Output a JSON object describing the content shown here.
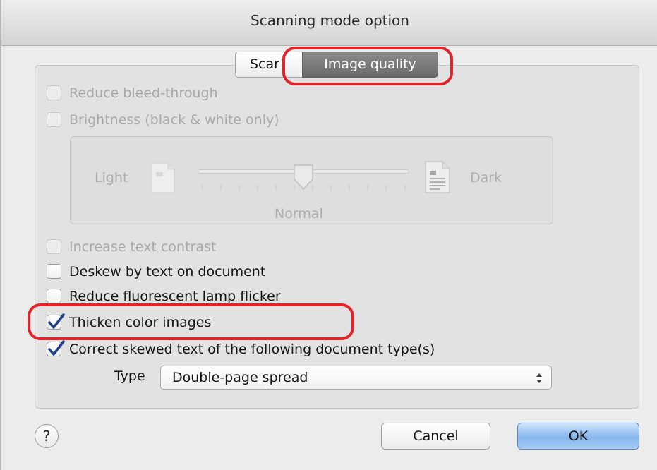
{
  "window": {
    "title": "Scanning mode option"
  },
  "tabs": [
    {
      "label": "Scan",
      "visible_label": "Scar",
      "selected": false
    },
    {
      "label": "Image quality",
      "selected": true
    }
  ],
  "options": {
    "reduce_bleed_through": {
      "label": "Reduce bleed-through",
      "checked": false,
      "enabled": false
    },
    "brightness": {
      "label": "Brightness (black & white only)",
      "checked": false,
      "enabled": false
    },
    "increase_text_contrast": {
      "label": "Increase text contrast",
      "checked": false,
      "enabled": false
    },
    "deskew_by_text": {
      "label": "Deskew by text on document",
      "checked": false,
      "enabled": true
    },
    "reduce_lamp_flicker": {
      "label": "Reduce fluorescent lamp flicker",
      "checked": false,
      "enabled": true
    },
    "thicken_color_images": {
      "label": "Thicken color images",
      "checked": true,
      "enabled": true
    },
    "correct_skewed_text": {
      "label": "Correct skewed text of the following document type(s)",
      "checked": true,
      "enabled": true
    }
  },
  "brightness_slider": {
    "min_label": "Light",
    "max_label": "Dark",
    "value_label": "Normal",
    "value_fraction": 0.5,
    "enabled": false
  },
  "type_select": {
    "label": "Type",
    "value": "Double-page spread"
  },
  "buttons": {
    "help": "?",
    "cancel": "Cancel",
    "ok": "OK"
  },
  "colors": {
    "highlight": "#e0242c",
    "selected_tab": "#7a7a7a",
    "checkmark": "#1f3f86",
    "ok_button": "#86b6ee"
  },
  "icons": {
    "light_doc": "page-light-icon",
    "dark_doc": "page-dark-icon",
    "select_arrows": "updown-chevron-icon",
    "help": "help-icon"
  }
}
